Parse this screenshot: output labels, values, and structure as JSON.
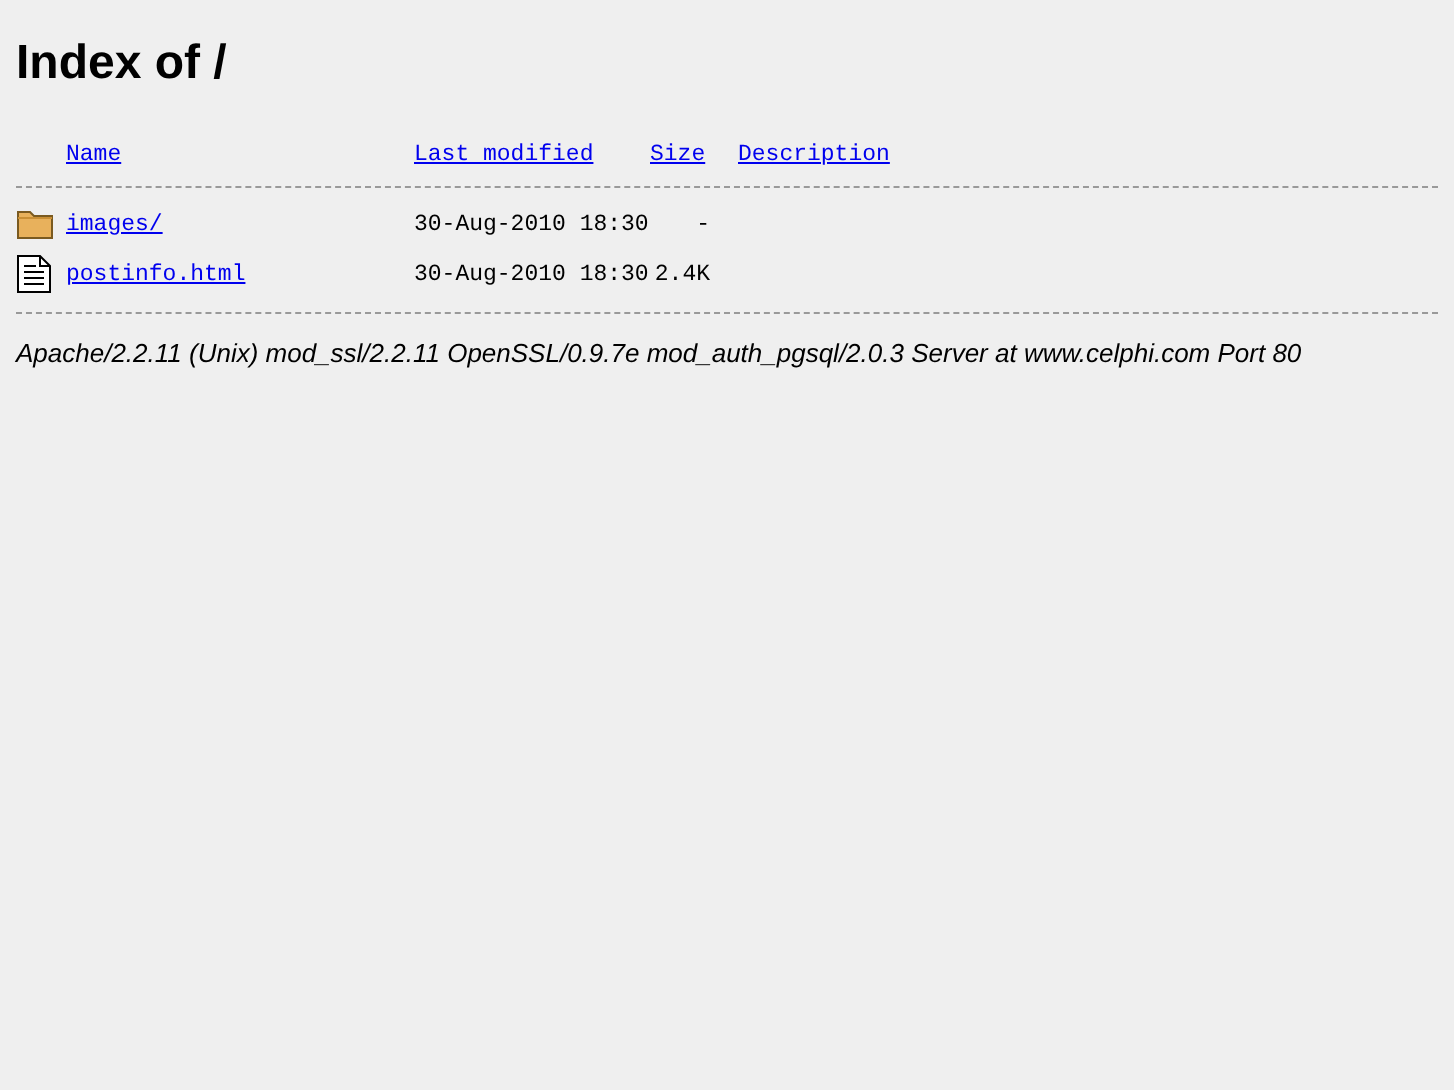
{
  "title": "Index of /",
  "columns": [
    "Name",
    "Last modified",
    "Size",
    "Description"
  ],
  "rows": [
    {
      "kind": "folder",
      "name": "images/",
      "modified": "30-Aug-2010 18:30",
      "size": "-"
    },
    {
      "kind": "file",
      "name": "postinfo.html",
      "modified": "30-Aug-2010 18:30",
      "size": "2.4K"
    }
  ],
  "footer": "Apache/2.2.11 (Unix) mod_ssl/2.2.11 OpenSSL/0.9.7e mod_auth_pgsql/2.0.3 Server at www.celphi.com Port 80"
}
